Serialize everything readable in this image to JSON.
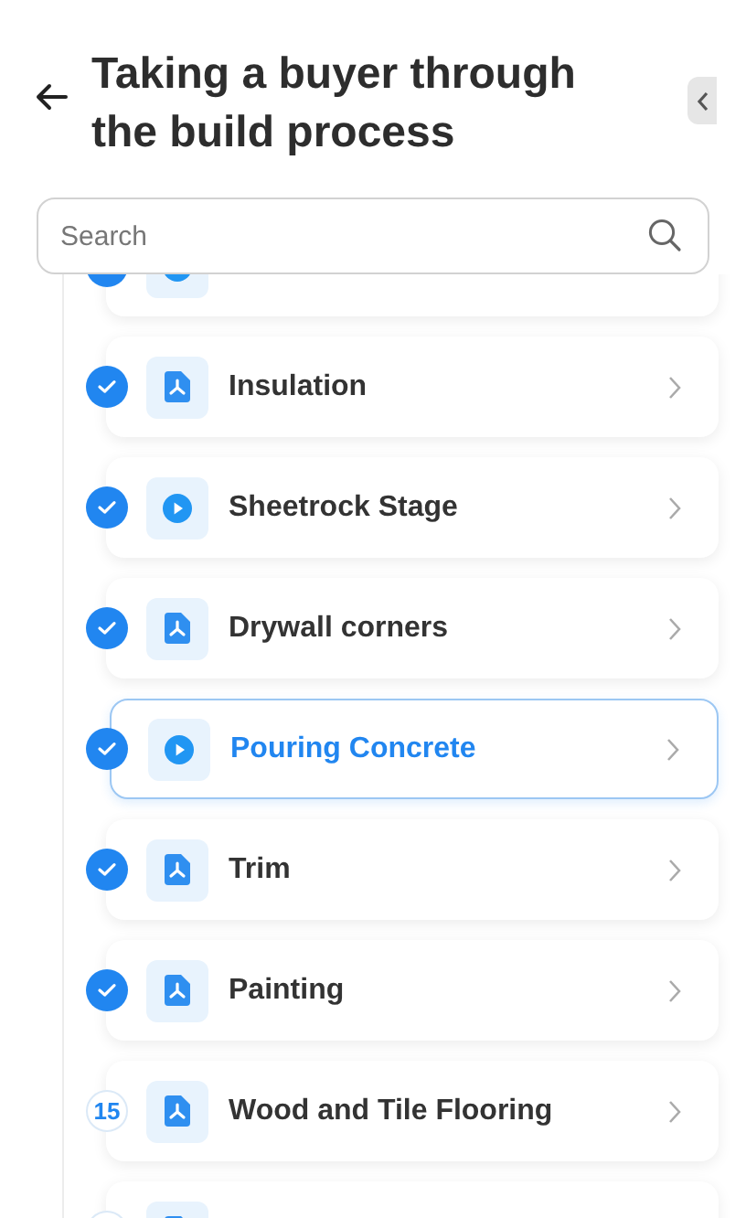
{
  "header": {
    "title": "Taking a buyer through the build process"
  },
  "search": {
    "placeholder": "Search"
  },
  "lessons": [
    {
      "kind": "video",
      "done": true,
      "selected": false
    },
    {
      "kind": "pdf",
      "done": true,
      "selected": false,
      "title": "Insulation"
    },
    {
      "kind": "video",
      "done": true,
      "selected": false,
      "title": "Sheetrock Stage"
    },
    {
      "kind": "pdf",
      "done": true,
      "selected": false,
      "title": "Drywall corners"
    },
    {
      "kind": "video",
      "done": true,
      "selected": true,
      "title": "Pouring Concrete"
    },
    {
      "kind": "pdf",
      "done": true,
      "selected": false,
      "title": "Trim"
    },
    {
      "kind": "pdf",
      "done": true,
      "selected": false,
      "title": "Painting"
    },
    {
      "kind": "pdf",
      "done": false,
      "selected": false,
      "number": "15",
      "title": "Wood and Tile Flooring"
    },
    {
      "kind": "pdf",
      "done": false,
      "selected": false
    }
  ]
}
